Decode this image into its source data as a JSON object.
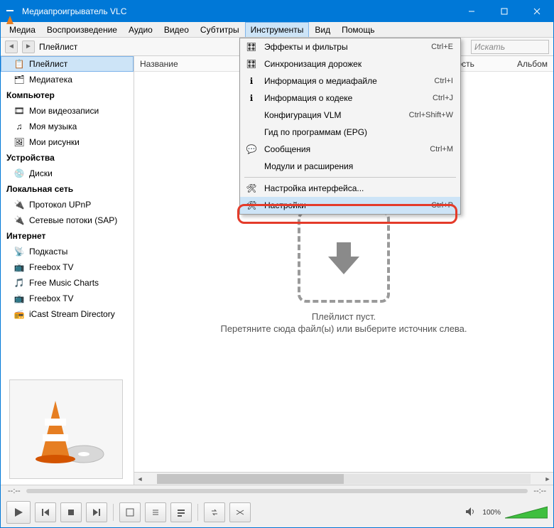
{
  "window": {
    "title": "Медиапроигрыватель VLC"
  },
  "menubar": [
    "Медиа",
    "Воспроизведение",
    "Аудио",
    "Видео",
    "Субтитры",
    "Инструменты",
    "Вид",
    "Помощь"
  ],
  "menubar_open_index": 5,
  "toolbar": {
    "crumb": "Плейлист",
    "search_placeholder": "Искать"
  },
  "sidebar": [
    {
      "type": "item",
      "label": "Плейлист",
      "icon": "📋",
      "selected": true
    },
    {
      "type": "item",
      "label": "Медиатека",
      "icon": "🗂"
    },
    {
      "type": "header",
      "label": "Компьютер"
    },
    {
      "type": "item",
      "label": "Мои видеозаписи",
      "icon": "🎞"
    },
    {
      "type": "item",
      "label": "Моя музыка",
      "icon": "♫"
    },
    {
      "type": "item",
      "label": "Мои рисунки",
      "icon": "🖼"
    },
    {
      "type": "header",
      "label": "Устройства"
    },
    {
      "type": "item",
      "label": "Диски",
      "icon": "💿"
    },
    {
      "type": "header",
      "label": "Локальная сеть"
    },
    {
      "type": "item",
      "label": "Протокол UPnP",
      "icon": "🔌"
    },
    {
      "type": "item",
      "label": "Сетевые потоки (SAP)",
      "icon": "🔌"
    },
    {
      "type": "header",
      "label": "Интернет"
    },
    {
      "type": "item",
      "label": "Подкасты",
      "icon": "📡"
    },
    {
      "type": "item",
      "label": "Freebox TV",
      "icon": "📺"
    },
    {
      "type": "item",
      "label": "Free Music Charts",
      "icon": "🎵"
    },
    {
      "type": "item",
      "label": "Freebox TV",
      "icon": "📺"
    },
    {
      "type": "item",
      "label": "iCast Stream Directory",
      "icon": "📻"
    }
  ],
  "list_columns": {
    "name": "Название",
    "duration": "льность",
    "album": "Альбом"
  },
  "empty": {
    "line1": "Плейлист пуст.",
    "line2": "Перетяните сюда файл(ы) или выберите источник слева."
  },
  "dropdown": [
    {
      "icon": "🎛",
      "label": "Эффекты и фильтры",
      "shortcut": "Ctrl+E"
    },
    {
      "icon": "🎛",
      "label": "Синхронизация дорожек",
      "shortcut": ""
    },
    {
      "icon": "ℹ",
      "label": "Информация о медиафайле",
      "shortcut": "Ctrl+I"
    },
    {
      "icon": "ℹ",
      "label": "Информация о кодеке",
      "shortcut": "Ctrl+J"
    },
    {
      "icon": "",
      "label": "Конфигурация VLM",
      "shortcut": "Ctrl+Shift+W"
    },
    {
      "icon": "",
      "label": "Гид по программам (EPG)",
      "shortcut": ""
    },
    {
      "icon": "💬",
      "label": "Сообщения",
      "shortcut": "Ctrl+M"
    },
    {
      "icon": "",
      "label": "Модули и расширения",
      "shortcut": ""
    },
    {
      "sep": true
    },
    {
      "icon": "🛠",
      "label": "Настройка интерфейса...",
      "shortcut": ""
    },
    {
      "icon": "🛠",
      "label": "Настройки",
      "shortcut": "Ctrl+P",
      "highlight": true
    }
  ],
  "seek": {
    "left": "--:--",
    "right": "--:--"
  },
  "volume": {
    "percent": "100%"
  }
}
